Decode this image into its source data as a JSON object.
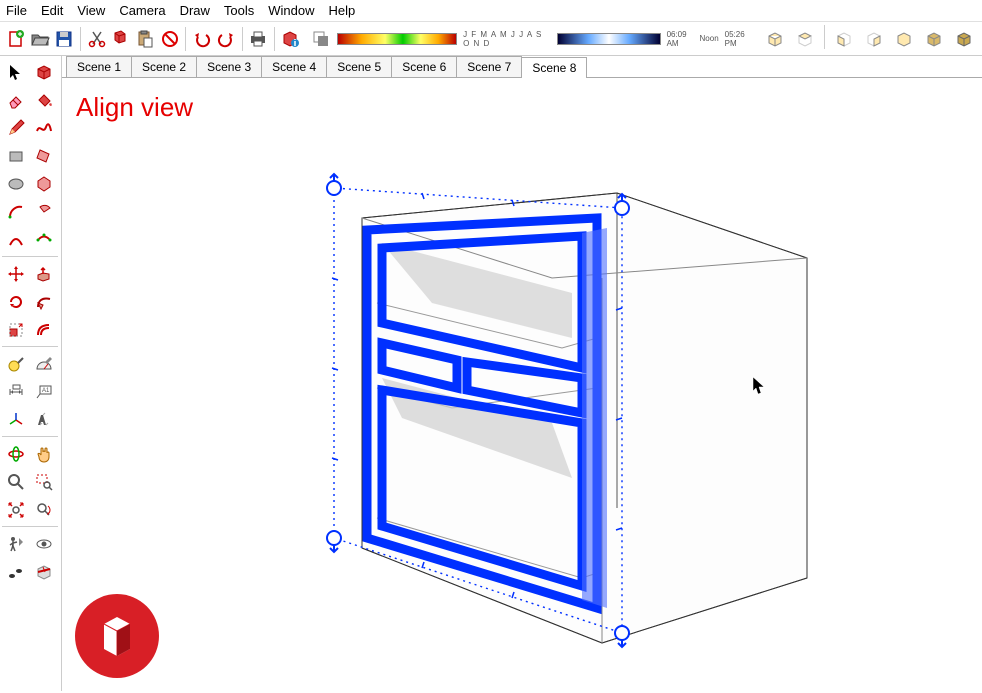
{
  "menu": {
    "items": [
      "File",
      "Edit",
      "View",
      "Camera",
      "Draw",
      "Tools",
      "Window",
      "Help"
    ]
  },
  "toolbar": {
    "buttons": [
      {
        "name": "new-file-icon"
      },
      {
        "name": "open-file-icon"
      },
      {
        "name": "save-file-icon"
      },
      {
        "sep": true
      },
      {
        "name": "cut-icon"
      },
      {
        "name": "copy-icon"
      },
      {
        "name": "paste-icon"
      },
      {
        "name": "delete-icon"
      },
      {
        "sep": true
      },
      {
        "name": "undo-icon"
      },
      {
        "name": "redo-icon"
      },
      {
        "sep": true
      },
      {
        "name": "print-icon"
      },
      {
        "sep": true
      },
      {
        "name": "model-info-icon"
      }
    ],
    "shadow": {
      "months": "J F M A M J J A S O N D",
      "sunrise": "06:09 AM",
      "noon": "Noon",
      "sunset": "05:26 PM"
    },
    "views": [
      {
        "name": "iso-view-icon"
      },
      {
        "name": "top-view-icon"
      },
      {
        "name": "front-view-icon"
      },
      {
        "name": "right-view-icon"
      },
      {
        "name": "back-view-icon"
      },
      {
        "name": "left-view-icon"
      },
      {
        "name": "persp-view-icon"
      }
    ]
  },
  "palette": [
    "select-tool",
    "make-component-tool",
    "eraser-tool",
    "paint-bucket-tool",
    "pencil-tool",
    "freehand-tool",
    "rectangle-tool",
    "rotated-rect-tool",
    "circle-tool",
    "polygon-tool",
    "arc-tool",
    "pie-tool",
    "two-point-arc-tool",
    "three-point-arc-tool",
    "sep",
    "sep2",
    "move-tool",
    "push-pull-tool",
    "rotate-tool",
    "follow-me-tool",
    "scale-tool",
    "offset-tool",
    "sep3",
    "sep4",
    "tape-measure-tool",
    "protractor-tool",
    "dimension-tool",
    "text-tool",
    "axes-tool",
    "3d-text-tool",
    "sep5",
    "sep6",
    "orbit-tool",
    "pan-tool",
    "zoom-tool",
    "zoom-window-tool",
    "zoom-extents-tool",
    "previous-view-tool",
    "sep7",
    "sep8",
    "position-camera-tool",
    "look-around-tool",
    "walk-tool",
    "section-plane-tool"
  ],
  "tabs": {
    "items": [
      "Scene 1",
      "Scene 2",
      "Scene 3",
      "Scene 4",
      "Scene 5",
      "Scene 6",
      "Scene 7",
      "Scene 8"
    ],
    "active": 7
  },
  "viewport": {
    "heading": "Align view"
  },
  "colors": {
    "accent": "#e60000",
    "select": "#0030ff",
    "handle": "#0030ff"
  }
}
